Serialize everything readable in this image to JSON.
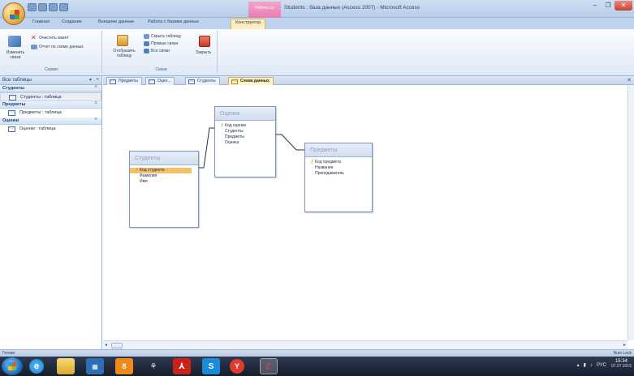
{
  "window": {
    "title": "Students : база данных (Access 2007) - Microsoft Access",
    "context_tab_header": "Работа со связями"
  },
  "ribbon_tabs": [
    "Главная",
    "Создание",
    "Внешние данные",
    "Работа с базами данных",
    "Конструктор"
  ],
  "ribbon": {
    "groups": {
      "service": {
        "label": "Сервис",
        "edit_relationships": "Изменить связи",
        "clear_layout": "Очистить макет",
        "relationship_report": "Отчет по схеме данных"
      },
      "relationships": {
        "label": "Связи",
        "show_table": "Отобразить таблицу",
        "hide_table": "Скрыть таблицу",
        "direct_relationships": "Прямые связи",
        "all_relationships": "Все связи",
        "close": "Закрыть"
      }
    }
  },
  "nav": {
    "header": "Все таблицы",
    "groups": [
      {
        "name": "Студенты",
        "items": [
          "Студенты : таблица"
        ]
      },
      {
        "name": "Предметы",
        "items": [
          "Предметы : таблица"
        ]
      },
      {
        "name": "Оценки",
        "items": [
          "Оценки : таблица"
        ]
      }
    ]
  },
  "doc_tabs": [
    "Предметы",
    "Оцен...",
    "Студенты",
    "Схема данных"
  ],
  "diagram": {
    "tables": [
      {
        "name": "Студенты",
        "fields": [
          "Код студента",
          "Фамилия",
          "Имя"
        ],
        "key_field": "Код студента",
        "selected_field": "Код студента"
      },
      {
        "name": "Оценки",
        "fields": [
          "Код оценки",
          "Студенты",
          "Предметы",
          "Оценка"
        ],
        "key_field": "Код оценки"
      },
      {
        "name": "Предметы",
        "fields": [
          "Код предмета",
          "Название",
          "Преподаватель"
        ],
        "key_field": "Код предмета"
      }
    ]
  },
  "status": {
    "left": "Готово",
    "right": "Num Lock"
  },
  "taskbar": {
    "lang": "РУС",
    "time": "15:34",
    "date": "07.07.2015"
  },
  "colors": {
    "ribbon_bg": "#dfe9f6",
    "selection": "#f2c168",
    "active_tab": "#fff3c7",
    "taskbar": "#1b2233"
  }
}
